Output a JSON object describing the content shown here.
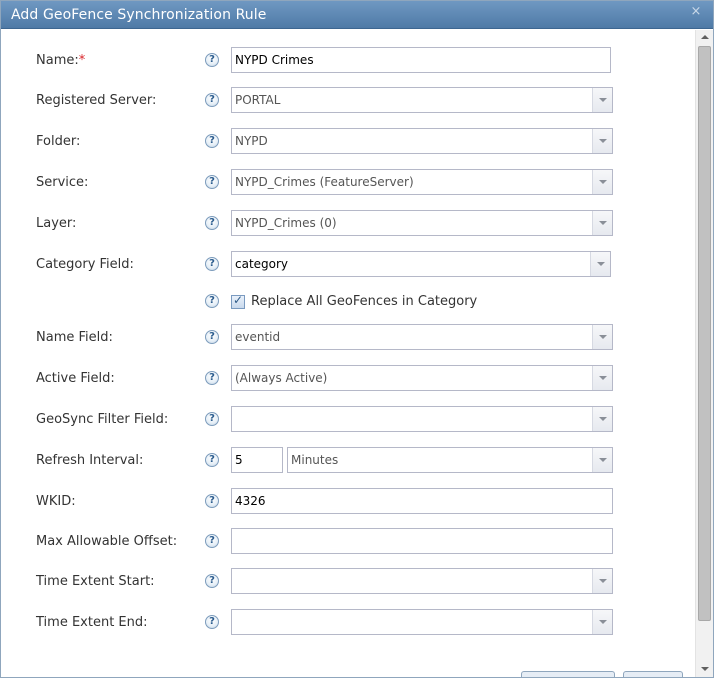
{
  "dialog": {
    "title": "Add GeoFence Synchronization Rule",
    "close_glyph": "×"
  },
  "help_glyph": "?",
  "fields": {
    "name": {
      "label": "Name:",
      "required_mark": "*",
      "value": "NYPD Crimes"
    },
    "registered_server": {
      "label": "Registered Server:",
      "value": "PORTAL"
    },
    "folder": {
      "label": "Folder:",
      "value": "NYPD"
    },
    "service": {
      "label": "Service:",
      "value": "NYPD_Crimes (FeatureServer)"
    },
    "layer": {
      "label": "Layer:",
      "value": "NYPD_Crimes (0)"
    },
    "category_field": {
      "label": "Category Field:",
      "value": "category"
    },
    "replace_all": {
      "label": "Replace All GeoFences in Category",
      "checked": true,
      "check_glyph": "✓"
    },
    "name_field": {
      "label": "Name Field:",
      "value": "eventid"
    },
    "active_field": {
      "label": "Active Field:",
      "value": "(Always Active)"
    },
    "geosync_filter_field": {
      "label": "GeoSync Filter Field:",
      "value": ""
    },
    "refresh_interval": {
      "label": "Refresh Interval:",
      "value": "5",
      "unit": "Minutes"
    },
    "wkid": {
      "label": "WKID:",
      "value": "4326"
    },
    "max_allowable_offset": {
      "label": "Max Allowable Offset:",
      "value": ""
    },
    "time_extent_start": {
      "label": "Time Extent Start:",
      "value": ""
    },
    "time_extent_end": {
      "label": "Time Extent End:",
      "value": ""
    }
  },
  "colors": {
    "titlebar": "#5a85b0",
    "required": "#d9262b"
  }
}
